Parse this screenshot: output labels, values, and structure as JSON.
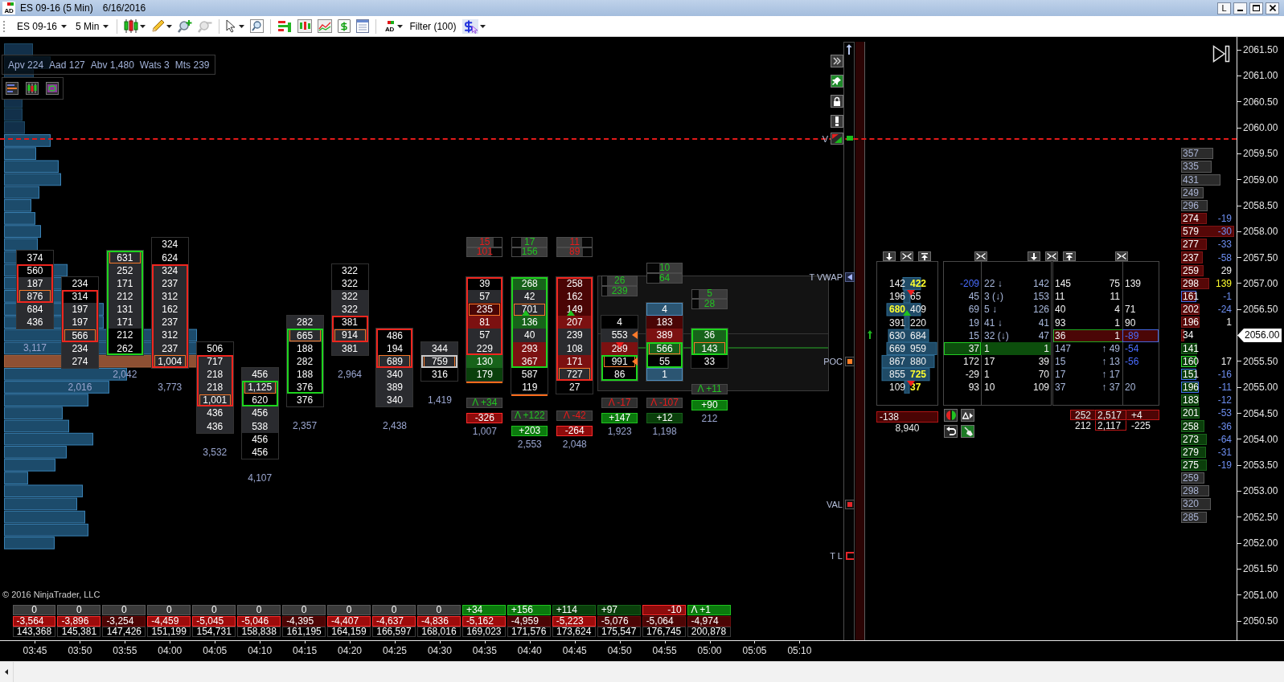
{
  "window": {
    "logo": "AD",
    "title": "ES 09-16 (5 Min)",
    "date": "6/16/2016",
    "button": "L"
  },
  "toolbar": {
    "instrument": "ES 09-16",
    "interval": "5 Min",
    "logo": "AD",
    "filter": "Filter (100)"
  },
  "stats": [
    {
      "label": "Apv",
      "value": "224"
    },
    {
      "label": "Aad",
      "value": "127"
    },
    {
      "label": "Abv",
      "value": "1,480"
    },
    {
      "label": "Wats",
      "value": "3"
    },
    {
      "label": "Mts",
      "value": "239"
    }
  ],
  "bars": [
    {
      "kind": "down",
      "cells": [
        {
          "value": "374",
          "color": "#000000",
          "in_body": false,
          "poc": false
        },
        {
          "value": "560",
          "color": "#000000",
          "in_body": true,
          "poc": false
        },
        {
          "value": "187",
          "color": "#2a2b2f",
          "in_body": true,
          "poc": false
        },
        {
          "value": "876",
          "color": "#2a2b2f",
          "in_body": true,
          "poc": true
        },
        {
          "value": "684",
          "color": "#2a2b2f",
          "in_body": false,
          "poc": false
        },
        {
          "value": "436",
          "color": "#2a2b2f",
          "in_body": false,
          "poc": false
        }
      ],
      "total": "3,117"
    },
    {
      "kind": "down",
      "cells": [
        {
          "value": "234",
          "color": "#000000",
          "in_body": false,
          "poc": false
        },
        {
          "value": "314",
          "color": "#000000",
          "in_body": true,
          "poc": false
        },
        {
          "value": "197",
          "color": "#2a2b2f",
          "in_body": true,
          "poc": false
        },
        {
          "value": "197",
          "color": "#2a2b2f",
          "in_body": true,
          "poc": false
        },
        {
          "value": "566",
          "color": "#2a2b2f",
          "in_body": true,
          "poc": true
        },
        {
          "value": "234",
          "color": "#2a2b2f",
          "in_body": false,
          "poc": false
        },
        {
          "value": "274",
          "color": "#2a2b2f",
          "in_body": false,
          "poc": false
        }
      ],
      "total": "2,016"
    },
    {
      "kind": "up",
      "cells": [
        {
          "value": "631",
          "color": "#2a2b2f",
          "in_body": true,
          "poc": true
        },
        {
          "value": "252",
          "color": "#2a2b2f",
          "in_body": true,
          "poc": false
        },
        {
          "value": "171",
          "color": "#2a2b2f",
          "in_body": true,
          "poc": false
        },
        {
          "value": "212",
          "color": "#2a2b2f",
          "in_body": true,
          "poc": false
        },
        {
          "value": "131",
          "color": "#2a2b2f",
          "in_body": true,
          "poc": false
        },
        {
          "value": "171",
          "color": "#2a2b2f",
          "in_body": true,
          "poc": false
        },
        {
          "value": "212",
          "color": "#000000",
          "in_body": true,
          "poc": false
        },
        {
          "value": "262",
          "color": "#000000",
          "in_body": true,
          "poc": false
        }
      ],
      "total": "2,042"
    },
    {
      "kind": "down",
      "cells": [
        {
          "value": "324",
          "color": "#000000",
          "in_body": false,
          "poc": false
        },
        {
          "value": "624",
          "color": "#000000",
          "in_body": false,
          "poc": false
        },
        {
          "value": "324",
          "color": "#2a2b2f",
          "in_body": true,
          "poc": false
        },
        {
          "value": "237",
          "color": "#2a2b2f",
          "in_body": true,
          "poc": false
        },
        {
          "value": "312",
          "color": "#2a2b2f",
          "in_body": true,
          "poc": false
        },
        {
          "value": "162",
          "color": "#2a2b2f",
          "in_body": true,
          "poc": false
        },
        {
          "value": "237",
          "color": "#2a2b2f",
          "in_body": true,
          "poc": false
        },
        {
          "value": "312",
          "color": "#2a2b2f",
          "in_body": true,
          "poc": false
        },
        {
          "value": "237",
          "color": "#2a2b2f",
          "in_body": true,
          "poc": false
        },
        {
          "value": "1,004",
          "color": "#2a2b2f",
          "in_body": true,
          "poc": true
        }
      ],
      "total": "3,773"
    },
    {
      "kind": "down",
      "cells": [
        {
          "value": "506",
          "color": "#000000",
          "in_body": false,
          "poc": false
        },
        {
          "value": "717",
          "color": "#2a2b2f",
          "in_body": true,
          "poc": false
        },
        {
          "value": "218",
          "color": "#2a2b2f",
          "in_body": true,
          "poc": false
        },
        {
          "value": "218",
          "color": "#2a2b2f",
          "in_body": true,
          "poc": false
        },
        {
          "value": "1,001",
          "color": "#2a2b2f",
          "in_body": true,
          "poc": true
        },
        {
          "value": "436",
          "color": "#2a2b2f",
          "in_body": false,
          "poc": false
        },
        {
          "value": "436",
          "color": "#2a2b2f",
          "in_body": false,
          "poc": false
        }
      ],
      "total": "3,532"
    },
    {
      "kind": "up",
      "cells": [
        {
          "value": "456",
          "color": "#2a2b2f",
          "in_body": false,
          "poc": false
        },
        {
          "value": "1,125",
          "color": "#2a2b2f",
          "in_body": true,
          "poc": true
        },
        {
          "value": "620",
          "color": "#000000",
          "in_body": true,
          "poc": false
        },
        {
          "value": "456",
          "color": "#2a2b2f",
          "in_body": false,
          "poc": false
        },
        {
          "value": "538",
          "color": "#2a2b2f",
          "in_body": false,
          "poc": false
        },
        {
          "value": "456",
          "color": "#000000",
          "in_body": false,
          "poc": false
        },
        {
          "value": "456",
          "color": "#000000",
          "in_body": false,
          "poc": false
        }
      ],
      "total": "4,107"
    },
    {
      "kind": "up",
      "cells": [
        {
          "value": "282",
          "color": "#2a2b2f",
          "in_body": false,
          "poc": false
        },
        {
          "value": "665",
          "color": "#2a2b2f",
          "in_body": true,
          "poc": true
        },
        {
          "value": "188",
          "color": "#000000",
          "in_body": true,
          "poc": false
        },
        {
          "value": "282",
          "color": "#000000",
          "in_body": true,
          "poc": false
        },
        {
          "value": "188",
          "color": "#000000",
          "in_body": true,
          "poc": false
        },
        {
          "value": "376",
          "color": "#000000",
          "in_body": true,
          "poc": false
        },
        {
          "value": "376",
          "color": "#000000",
          "in_body": false,
          "poc": false
        }
      ],
      "total": "2,357"
    },
    {
      "kind": "down",
      "cells": [
        {
          "value": "322",
          "color": "#000000",
          "in_body": false,
          "poc": false
        },
        {
          "value": "322",
          "color": "#000000",
          "in_body": false,
          "poc": false
        },
        {
          "value": "322",
          "color": "#2a2b2f",
          "in_body": false,
          "poc": false
        },
        {
          "value": "322",
          "color": "#2a2b2f",
          "in_body": false,
          "poc": false
        },
        {
          "value": "381",
          "color": "#000000",
          "in_body": true,
          "poc": false
        },
        {
          "value": "914",
          "color": "#2a2b2f",
          "in_body": true,
          "poc": true
        },
        {
          "value": "381",
          "color": "#2a2b2f",
          "in_body": false,
          "poc": false
        }
      ],
      "total": "2,964"
    },
    {
      "kind": "down",
      "cells": [
        {
          "value": "486",
          "color": "#000000",
          "in_body": true,
          "poc": false
        },
        {
          "value": "194",
          "color": "#000000",
          "in_body": true,
          "poc": false
        },
        {
          "value": "689",
          "color": "#2a2b2f",
          "in_body": true,
          "poc": true
        },
        {
          "value": "340",
          "color": "#2a2b2f",
          "in_body": false,
          "poc": false
        },
        {
          "value": "389",
          "color": "#2a2b2f",
          "in_body": false,
          "poc": false
        },
        {
          "value": "340",
          "color": "#2a2b2f",
          "in_body": false,
          "poc": false
        }
      ],
      "total": "2,438"
    },
    {
      "kind": "flat",
      "cells": [
        {
          "value": "344",
          "color": "#2a2b2f",
          "in_body": false,
          "poc": false
        },
        {
          "value": "759",
          "color": "#2a2b2f",
          "in_body": true,
          "poc": true
        },
        {
          "value": "316",
          "color": "#000000",
          "in_body": false,
          "poc": false
        }
      ],
      "total": "1,419"
    },
    {
      "kind": "down",
      "imbalance": [
        {
          "value": "15",
          "kind": "sell",
          "level": 0.76
        },
        {
          "value": "101",
          "kind": "sell",
          "level": 0.69
        }
      ],
      "cells": [
        {
          "value": "39",
          "color": "#000000",
          "in_body": true,
          "poc": false
        },
        {
          "value": "57",
          "color": "#2a2b2f",
          "in_body": true,
          "poc": false
        },
        {
          "value": "235",
          "color": "#4a0505",
          "in_body": true,
          "poc": true
        },
        {
          "value": "81",
          "color": "#7c1111",
          "in_body": true,
          "poc": false
        },
        {
          "value": "57",
          "color": "#2a2b2f",
          "in_body": true,
          "poc": false
        },
        {
          "value": "229",
          "color": "#2a2b2f",
          "in_body": true,
          "poc": false
        },
        {
          "value": "130",
          "color": "#17631a",
          "in_body": false,
          "poc": false
        },
        {
          "value": "179",
          "color": "#0a400c",
          "in_body": false,
          "poc": false
        }
      ],
      "underlined": true,
      "change": {
        "value": "Λ +34",
        "kind": "gain"
      },
      "delta": {
        "value": "-326",
        "color": "#8e0b0b"
      },
      "total": "1,007"
    },
    {
      "kind": "up",
      "imbalance": [
        {
          "value": "17",
          "kind": "buy",
          "level": 0.74
        },
        {
          "value": "156",
          "kind": "buy",
          "level": 0.74
        }
      ],
      "cells": [
        {
          "value": "268",
          "color": "#17631a",
          "in_body": true,
          "poc": false,
          "kind": "plain"
        },
        {
          "value": "42",
          "color": "#2a2b2f",
          "in_body": true,
          "poc": false,
          "kind": "plain"
        },
        {
          "value": "701",
          "color": "#2a2b2f",
          "in_body": true,
          "poc": true,
          "kind": "up"
        },
        {
          "value": "136",
          "color": "#17631a",
          "in_body": true,
          "poc": false,
          "kind": "plain"
        },
        {
          "value": "40",
          "color": "#2a2b2f",
          "in_body": true,
          "poc": false,
          "kind": "plain"
        },
        {
          "value": "293",
          "color": "#7c1111",
          "in_body": true,
          "poc": false,
          "kind": "plain"
        },
        {
          "value": "367",
          "color": "#7c1111",
          "in_body": true,
          "poc": false,
          "kind": "plain"
        },
        {
          "value": "587",
          "color": "#000000",
          "in_body": false,
          "poc": false,
          "kind": "plain"
        },
        {
          "value": "119",
          "color": "#000000",
          "in_body": false,
          "poc": false,
          "kind": "plain"
        }
      ],
      "underlined": true,
      "change": {
        "value": "Λ +122",
        "kind": "gain"
      },
      "delta": {
        "value": "+203",
        "color": "#0b7a0d"
      },
      "total": "2,553"
    },
    {
      "kind": "down",
      "imbalance": [
        {
          "value": "11",
          "kind": "sell",
          "level": 0.72
        },
        {
          "value": "89",
          "kind": "sell",
          "level": 0.75
        }
      ],
      "cells": [
        {
          "value": "258",
          "color": "#4a0505",
          "in_body": true,
          "poc": false,
          "kind": "plain"
        },
        {
          "value": "162",
          "color": "#4a0505",
          "in_body": true,
          "poc": false,
          "kind": "plain"
        },
        {
          "value": "149",
          "color": "#4a0505",
          "in_body": true,
          "poc": false,
          "kind": "up"
        },
        {
          "value": "207",
          "color": "#7c1111",
          "in_body": true,
          "poc": false,
          "kind": "plain"
        },
        {
          "value": "239",
          "color": "#2a2b2f",
          "in_body": true,
          "poc": false,
          "kind": "plain"
        },
        {
          "value": "108",
          "color": "#2a2b2f",
          "in_body": true,
          "poc": false,
          "kind": "plain"
        },
        {
          "value": "171",
          "color": "#7c1111",
          "in_body": true,
          "poc": false,
          "kind": "plain"
        },
        {
          "value": "727",
          "color": "#2a2b2f",
          "in_body": true,
          "poc": true,
          "kind": "plain"
        },
        {
          "value": "27",
          "color": "#000000",
          "in_body": false,
          "poc": false,
          "kind": "plain"
        }
      ],
      "underlined": false,
      "change": {
        "value": "Λ -42",
        "kind": "loss"
      },
      "delta": {
        "value": "-264",
        "color": "#8e0b0b"
      },
      "total": "2,048"
    },
    {
      "kind": "up",
      "imbalance": [
        {
          "value": "26",
          "kind": "buy",
          "level": 0.87
        },
        {
          "value": "239",
          "kind": "buy",
          "level": 0.87
        }
      ],
      "cells": [
        {
          "value": "4",
          "color": "#000000",
          "in_body": false,
          "poc": false,
          "kind": "plain"
        },
        {
          "value": "553",
          "color": "#2a2b2f",
          "in_body": false,
          "poc": false,
          "kind": "left"
        },
        {
          "value": "289",
          "color": "#7c1111",
          "in_body": false,
          "poc": false,
          "kind": "down"
        },
        {
          "value": "991",
          "color": "#000000",
          "in_body": true,
          "poc": true,
          "kind": "left"
        },
        {
          "value": "86",
          "color": "#000000",
          "in_body": true,
          "poc": false,
          "kind": "plain"
        }
      ],
      "underlined": false,
      "change": {
        "value": "Λ -17",
        "kind": "loss"
      },
      "delta": {
        "value": "+147",
        "color": "#0b7a0d"
      },
      "total": "1,923"
    },
    {
      "kind": "up",
      "imbalance": [
        {
          "value": "10",
          "kind": "buy",
          "level": 0.66
        },
        {
          "value": "64",
          "kind": "buy",
          "level": 0.66
        }
      ],
      "cells": [
        {
          "value": "4",
          "color": "#2b5572",
          "in_body": false,
          "poc": false
        },
        {
          "value": "183",
          "color": "#4a0505",
          "in_body": false,
          "poc": false
        },
        {
          "value": "389",
          "color": "#7c1111",
          "in_body": false,
          "poc": false
        },
        {
          "value": "566",
          "color": "#17631a",
          "in_body": true,
          "poc": true
        },
        {
          "value": "55",
          "color": "#000000",
          "in_body": true,
          "poc": false
        },
        {
          "value": "1",
          "color": "#2b5572",
          "in_body": false,
          "poc": false
        }
      ],
      "underlined": false,
      "change": {
        "value": "Λ -107",
        "kind": "loss"
      },
      "delta": {
        "value": "+12",
        "color": "#0a3f0b"
      },
      "total": "1,198"
    },
    {
      "kind": "up",
      "imbalance": [
        {
          "value": "5",
          "kind": "buy",
          "level": 0.82
        },
        {
          "value": "28",
          "kind": "buy",
          "level": 0.82
        }
      ],
      "cells": [
        {
          "value": "36",
          "color": "#17631a",
          "in_body": true,
          "poc": false
        },
        {
          "value": "143",
          "color": "#17631a",
          "in_body": true,
          "poc": true
        },
        {
          "value": "33",
          "color": "#000000",
          "in_body": false,
          "poc": false
        }
      ],
      "underlined": false,
      "change": {
        "value": "Λ +11",
        "kind": "gain"
      },
      "delta": {
        "value": "+90",
        "color": "#0b7a0d"
      },
      "total": "212"
    }
  ],
  "levels": [
    {
      "label": "V",
      "kind": "flag"
    },
    {
      "label": "T VWAP",
      "kind": "triangle"
    },
    {
      "label": "POC",
      "kind": "square",
      "color": "#ff7f27"
    },
    {
      "label": "VAL",
      "kind": "square",
      "color": "#e5262a"
    },
    {
      "label": "T L",
      "kind": "line",
      "color": "#e5262a"
    }
  ],
  "ladder": {
    "panel_1": {
      "rows": [
        {
          "kind": "plain",
          "column_1": {
            "value": "142",
            "highlight": false
          },
          "column_2": {
            "value": "422",
            "highlight": true
          }
        },
        {
          "kind": "down",
          "column_1": {
            "value": "196",
            "highlight": false
          },
          "column_2": {
            "value": "65",
            "highlight": false
          }
        },
        {
          "kind": "up",
          "column_1": {
            "value": "680",
            "highlight": true
          },
          "column_2": {
            "value": "409",
            "highlight": false
          }
        },
        {
          "kind": "plain",
          "column_1": {
            "value": "391",
            "highlight": false
          },
          "column_2": {
            "value": "220",
            "highlight": false
          }
        },
        {
          "kind": "plain",
          "column_1": {
            "value": "630",
            "highlight": false
          },
          "column_2": {
            "value": "684",
            "highlight": false
          }
        },
        {
          "kind": "plain",
          "column_1": {
            "value": "669",
            "highlight": false
          },
          "column_2": {
            "value": "959",
            "highlight": false
          }
        },
        {
          "kind": "plain",
          "column_1": {
            "value": "867",
            "highlight": false
          },
          "column_2": {
            "value": "880",
            "highlight": false
          }
        },
        {
          "kind": "plain",
          "column_1": {
            "value": "855",
            "highlight": false
          },
          "column_2": {
            "value": "725",
            "highlight": true
          }
        },
        {
          "kind": "down",
          "column_1": {
            "value": "109",
            "highlight": false
          },
          "column_2": {
            "value": "37",
            "highlight": true
          }
        }
      ],
      "delta": "-138",
      "volume": "8,940"
    },
    "panel_2": {
      "rows": [
        {
          "column_1": {
            "value": "-209",
            "muted": false,
            "accent": true
          },
          "column_2": {
            "value": "22 ↓",
            "muted": true,
            "accent": false
          },
          "column_3": {
            "value": "142",
            "muted": true,
            "accent": false
          },
          "selected": false
        },
        {
          "column_1": {
            "value": "45",
            "muted": true,
            "accent": false
          },
          "column_2": {
            "value": "3 (↓)",
            "muted": true,
            "accent": false
          },
          "column_3": {
            "value": "153",
            "muted": true,
            "accent": false
          },
          "selected": false
        },
        {
          "column_1": {
            "value": "69",
            "muted": true,
            "accent": false
          },
          "column_2": {
            "value": "5 ↓",
            "muted": true,
            "accent": false
          },
          "column_3": {
            "value": "126",
            "muted": true,
            "accent": false
          },
          "selected": false
        },
        {
          "column_1": {
            "value": "19",
            "muted": true,
            "accent": false
          },
          "column_2": {
            "value": "41 ↓",
            "muted": true,
            "accent": false
          },
          "column_3": {
            "value": "41",
            "muted": true,
            "accent": false
          },
          "selected": false
        },
        {
          "column_1": {
            "value": "15",
            "muted": true,
            "accent": false
          },
          "column_2": {
            "value": "32 (↓)",
            "muted": true,
            "accent": false
          },
          "column_3": {
            "value": "47",
            "muted": true,
            "accent": false
          },
          "selected": false
        },
        {
          "column_1": {
            "value": "37",
            "muted": false,
            "accent": false
          },
          "column_2": {
            "value": "1",
            "muted": false,
            "accent": false
          },
          "column_3": {
            "value": "1",
            "muted": false,
            "accent": false
          },
          "selected": true
        },
        {
          "column_1": {
            "value": "172",
            "muted": false,
            "accent": false
          },
          "column_2": {
            "value": "17",
            "muted": false,
            "accent": false
          },
          "column_3": {
            "value": "39",
            "muted": false,
            "accent": false
          },
          "selected": false
        },
        {
          "column_1": {
            "value": "-29",
            "muted": false,
            "accent": false
          },
          "column_2": {
            "value": "1",
            "muted": false,
            "accent": false
          },
          "column_3": {
            "value": "70",
            "muted": false,
            "accent": false
          },
          "selected": false
        },
        {
          "column_1": {
            "value": "93",
            "muted": false,
            "accent": false
          },
          "column_2": {
            "value": "10",
            "muted": false,
            "accent": false
          },
          "column_3": {
            "value": "109",
            "muted": false,
            "accent": false
          },
          "selected": false
        }
      ]
    },
    "panel_3": {
      "rows": [
        {
          "column_1": {
            "value": "145",
            "muted": false,
            "accent": false
          },
          "column_2": {
            "value": "75",
            "muted": false,
            "accent": false
          },
          "column_3": {
            "value": "139",
            "muted": false,
            "accent": false
          },
          "selected": false
        },
        {
          "column_1": {
            "value": "11",
            "muted": false,
            "accent": false
          },
          "column_2": {
            "value": "11",
            "muted": false,
            "accent": false
          },
          "selected": false
        },
        {
          "column_1": {
            "value": "40",
            "muted": false,
            "accent": false
          },
          "column_2": {
            "value": "4",
            "muted": false,
            "accent": false
          },
          "column_3": {
            "value": "71",
            "muted": false,
            "accent": false
          },
          "selected": false
        },
        {
          "column_1": {
            "value": "93",
            "muted": false,
            "accent": false
          },
          "column_2": {
            "value": "1",
            "muted": false,
            "accent": false
          },
          "column_3": {
            "value": "90",
            "muted": false,
            "accent": false
          },
          "selected": false
        },
        {
          "column_1": {
            "value": "36",
            "muted": false,
            "accent": false
          },
          "column_2": {
            "value": "1",
            "muted": false,
            "accent": false
          },
          "column_3": {
            "value": "-89",
            "muted": false,
            "accent": true
          },
          "selected": true
        },
        {
          "column_1": {
            "value": "147",
            "muted": true,
            "accent": false
          },
          "column_2": {
            "value": "↑ 49",
            "muted": true,
            "accent": false
          },
          "column_3": {
            "value": "-54",
            "muted": false,
            "accent": true
          },
          "selected": false
        },
        {
          "column_1": {
            "value": "15",
            "muted": true,
            "accent": false
          },
          "column_2": {
            "value": "↑ 13",
            "muted": true,
            "accent": false
          },
          "column_3": {
            "value": "-56",
            "muted": false,
            "accent": true
          },
          "selected": false
        },
        {
          "column_1": {
            "value": "17",
            "muted": true,
            "accent": false
          },
          "column_2": {
            "value": "↑ 17",
            "muted": true,
            "accent": false
          },
          "selected": false
        },
        {
          "column_1": {
            "value": "37",
            "muted": true,
            "accent": false
          },
          "column_2": {
            "value": "↑ 37",
            "muted": true,
            "accent": false
          },
          "column_3": {
            "value": "20",
            "muted": true,
            "accent": false
          },
          "selected": false
        }
      ],
      "totals": [
        {
          "column_1": "252",
          "column_2": "2,517",
          "column_3": "+4",
          "highlight": true
        },
        {
          "column_1": "212",
          "column_2": "2,117",
          "column_3": "-225",
          "highlight": false
        }
      ]
    }
  },
  "volume_column": [
    {
      "value": "357",
      "color": "#2b2b2b",
      "kind": "plain"
    },
    {
      "value": "335",
      "color": "#2b2b2b",
      "kind": "plain"
    },
    {
      "value": "431",
      "color": "#2b2b2b",
      "kind": "plain"
    },
    {
      "value": "249",
      "color": "#2b2b2b",
      "kind": "plain"
    },
    {
      "value": "296",
      "color": "#2b2b2b",
      "kind": "plain"
    },
    {
      "value": "274",
      "color": "#560707",
      "kind": "plain",
      "delta": "-19",
      "delta_accent": true,
      "delta_highlight": false
    },
    {
      "value": "579",
      "color": "#560707",
      "kind": "plain",
      "delta": "-30",
      "delta_accent": true,
      "delta_highlight": false
    },
    {
      "value": "277",
      "color": "#560707",
      "kind": "plain",
      "delta": "-33",
      "delta_accent": true,
      "delta_highlight": false
    },
    {
      "value": "237",
      "color": "#560707",
      "kind": "plain",
      "delta": "-58",
      "delta_accent": true,
      "delta_highlight": false
    },
    {
      "value": "259",
      "color": "#560707",
      "kind": "plain",
      "delta": "29",
      "delta_accent": false,
      "delta_highlight": false
    },
    {
      "value": "298",
      "color": "#560707",
      "kind": "plain",
      "delta": "139",
      "delta_accent": false,
      "delta_highlight": true
    },
    {
      "value": "161",
      "color": "#560707",
      "kind": "framed",
      "delta": "-1",
      "delta_accent": true,
      "delta_highlight": false
    },
    {
      "value": "202",
      "color": "#560707",
      "kind": "plain",
      "delta": "-24",
      "delta_accent": true,
      "delta_highlight": false
    },
    {
      "value": "196",
      "color": "#560707",
      "kind": "plain",
      "delta": "1",
      "delta_accent": false,
      "delta_highlight": false
    },
    {
      "value": "34",
      "color": "#560707",
      "kind": "plain"
    },
    {
      "value": "141",
      "color": "#0b3d0b",
      "kind": "plain"
    },
    {
      "value": "160",
      "color": "#0b3d0b",
      "kind": "active",
      "delta": "17",
      "delta_accent": false,
      "delta_highlight": false
    },
    {
      "value": "151",
      "color": "#0b3d0b",
      "kind": "framed",
      "delta": "-16",
      "delta_accent": true,
      "delta_highlight": false
    },
    {
      "value": "196",
      "color": "#0b3d0b",
      "kind": "framed",
      "delta": "-11",
      "delta_accent": true,
      "delta_highlight": false
    },
    {
      "value": "183",
      "color": "#0b3d0b",
      "kind": "plain",
      "delta": "-12",
      "delta_accent": true,
      "delta_highlight": false
    },
    {
      "value": "201",
      "color": "#0b3d0b",
      "kind": "plain",
      "delta": "-53",
      "delta_accent": true,
      "delta_highlight": false
    },
    {
      "value": "258",
      "color": "#0b3d0b",
      "kind": "plain",
      "delta": "-36",
      "delta_accent": true,
      "delta_highlight": false
    },
    {
      "value": "273",
      "color": "#0b3d0b",
      "kind": "plain",
      "delta": "-64",
      "delta_accent": true,
      "delta_highlight": false
    },
    {
      "value": "279",
      "color": "#0b3d0b",
      "kind": "plain",
      "delta": "-31",
      "delta_accent": true,
      "delta_highlight": false
    },
    {
      "value": "275",
      "color": "#0b3d0b",
      "kind": "plain",
      "delta": "-19",
      "delta_accent": true,
      "delta_highlight": false
    },
    {
      "value": "259",
      "color": "#2b2b2b",
      "kind": "plain"
    },
    {
      "value": "298",
      "color": "#2b2b2b",
      "kind": "plain"
    },
    {
      "value": "320",
      "color": "#2b2b2b",
      "kind": "plain"
    },
    {
      "value": "285",
      "color": "#2b2b2b",
      "kind": "plain"
    }
  ],
  "price_axis": [
    {
      "text": "2061.50",
      "current": false
    },
    {
      "text": "2061.00",
      "current": false
    },
    {
      "text": "2060.50",
      "current": false
    },
    {
      "text": "2060.00",
      "current": false
    },
    {
      "text": "2059.50",
      "current": false
    },
    {
      "text": "2059.00",
      "current": false
    },
    {
      "text": "2058.50",
      "current": false
    },
    {
      "text": "2058.00",
      "current": false
    },
    {
      "text": "2057.50",
      "current": false
    },
    {
      "text": "2057.00",
      "current": false
    },
    {
      "text": "2056.50",
      "current": false
    },
    {
      "text": "2056.00",
      "current": true
    },
    {
      "text": "2055.50",
      "current": false
    },
    {
      "text": "2055.00",
      "current": false
    },
    {
      "text": "2054.50",
      "current": false
    },
    {
      "text": "2054.00",
      "current": false
    },
    {
      "text": "2053.50",
      "current": false
    },
    {
      "text": "2053.00",
      "current": false
    },
    {
      "text": "2052.50",
      "current": false
    },
    {
      "text": "2052.00",
      "current": false
    },
    {
      "text": "2051.50",
      "current": false
    },
    {
      "text": "2051.00",
      "current": false
    },
    {
      "text": "2050.50",
      "current": false
    }
  ],
  "summary": {
    "row_1": [
      {
        "value": "0",
        "kind": "neutral",
        "color": "#3a3a3a"
      },
      {
        "value": "0",
        "kind": "neutral",
        "color": "#3a3a3a"
      },
      {
        "value": "0",
        "kind": "neutral",
        "color": "#3a3a3a"
      },
      {
        "value": "0",
        "kind": "neutral",
        "color": "#3a3a3a"
      },
      {
        "value": "0",
        "kind": "neutral",
        "color": "#3a3a3a"
      },
      {
        "value": "0",
        "kind": "neutral",
        "color": "#3a3a3a"
      },
      {
        "value": "0",
        "kind": "neutral",
        "color": "#3a3a3a"
      },
      {
        "value": "0",
        "kind": "neutral",
        "color": "#3a3a3a"
      },
      {
        "value": "0",
        "kind": "neutral",
        "color": "#3a3a3a"
      },
      {
        "value": "0",
        "kind": "neutral",
        "color": "#3a3a3a"
      },
      {
        "value": "+34",
        "kind": "positive",
        "color": "#0b7a0d"
      },
      {
        "value": "+156",
        "kind": "positive",
        "color": "#0b7a0d"
      },
      {
        "value": "+114",
        "kind": "positive",
        "color": "#0a3f0b"
      },
      {
        "value": "+97",
        "kind": "positive",
        "color": "#0a3f0b"
      },
      {
        "value": "-10",
        "kind": "negative",
        "color": "#8e0b0b"
      },
      {
        "value": "Λ +1",
        "kind": "positive",
        "color": "#0b7a0d"
      }
    ],
    "row_2": [
      {
        "value": "-3,564",
        "color": "#9e0b0b"
      },
      {
        "value": "-3,896",
        "color": "#9e0b0b"
      },
      {
        "value": "-3,254",
        "color": "#4c0505"
      },
      {
        "value": "-4,459",
        "color": "#9e0b0b"
      },
      {
        "value": "-5,045",
        "color": "#9e0b0b"
      },
      {
        "value": "-5,046",
        "color": "#9e0b0b"
      },
      {
        "value": "-4,395",
        "color": "#4c0505"
      },
      {
        "value": "-4,407",
        "color": "#9e0b0b"
      },
      {
        "value": "-4,637",
        "color": "#9e0b0b"
      },
      {
        "value": "-4,836",
        "color": "#9e0b0b"
      },
      {
        "value": "-5,162",
        "color": "#9e0b0b"
      },
      {
        "value": "-4,959",
        "color": "#4c0505"
      },
      {
        "value": "-5,223",
        "color": "#9e0b0b"
      },
      {
        "value": "-5,076",
        "color": "#4c0505"
      },
      {
        "value": "-5,064",
        "color": "#4c0505"
      },
      {
        "value": "-4,974",
        "color": "#4c0505"
      }
    ],
    "row_3": [
      "143,368",
      "145,381",
      "147,426",
      "151,199",
      "154,731",
      "158,838",
      "161,195",
      "164,159",
      "166,597",
      "168,016",
      "169,023",
      "171,576",
      "173,624",
      "175,547",
      "176,745",
      "200,878"
    ]
  },
  "copyright": "© 2016 NinjaTrader, LLC",
  "time_axis": [
    "03:45",
    "03:50",
    "03:55",
    "04:00",
    "04:05",
    "04:10",
    "04:15",
    "04:20",
    "04:25",
    "04:30",
    "04:35",
    "04:40",
    "04:45",
    "04:50",
    "04:55",
    "05:00",
    "05:05",
    "05:10"
  ]
}
